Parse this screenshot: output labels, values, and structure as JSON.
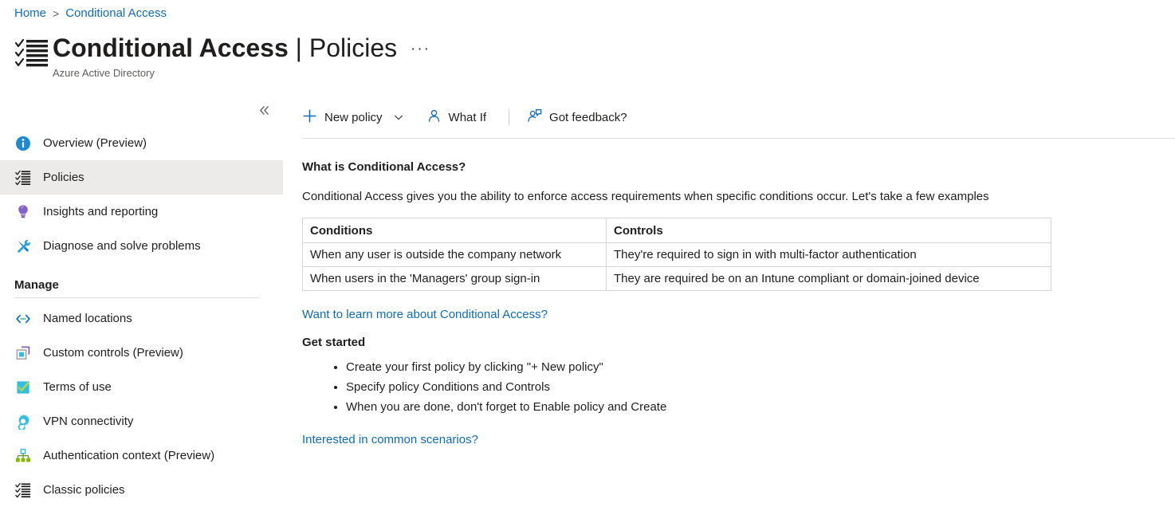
{
  "breadcrumb": {
    "home": "Home",
    "separator": ">",
    "current": "Conditional Access"
  },
  "header": {
    "title_bold": "Conditional Access",
    "title_separator": "|",
    "title_light": "Policies",
    "subtitle": "Azure Active Directory",
    "more_menu": "···",
    "icon": "checklist-icon"
  },
  "sidebar": {
    "collapse": "«",
    "items": [
      {
        "label": "Overview (Preview)",
        "icon": "info-circle-icon",
        "selected": false
      },
      {
        "label": "Policies",
        "icon": "checklist-icon",
        "selected": true
      },
      {
        "label": "Insights and reporting",
        "icon": "lightbulb-icon",
        "selected": false
      },
      {
        "label": "Diagnose and solve problems",
        "icon": "wrench-screwdriver-icon",
        "selected": false
      }
    ],
    "manage_section": {
      "title": "Manage",
      "items": [
        {
          "label": "Named locations",
          "icon": "code-brackets-icon"
        },
        {
          "label": "Custom controls (Preview)",
          "icon": "layers-square-icon"
        },
        {
          "label": "Terms of use",
          "icon": "checkbox-check-icon"
        },
        {
          "label": "VPN connectivity",
          "icon": "gear-icon"
        },
        {
          "label": "Authentication context (Preview)",
          "icon": "hierarchy-tree-icon"
        },
        {
          "label": "Classic policies",
          "icon": "checklist-icon"
        }
      ]
    }
  },
  "toolbar": {
    "new_policy": "New policy",
    "new_policy_icon": "plus-icon",
    "new_policy_chevron": "chevron-down-icon",
    "what_if": "What If",
    "what_if_icon": "person-icon",
    "got_feedback": "Got feedback?",
    "got_feedback_icon": "person-feedback-icon"
  },
  "main": {
    "heading": "What is Conditional Access?",
    "description": "Conditional Access gives you the ability to enforce access requirements when specific conditions occur. Let's take a few examples",
    "table": {
      "headers": [
        "Conditions",
        "Controls"
      ],
      "rows": [
        [
          "When any user is outside the company network",
          "They're required to sign in with multi-factor authentication"
        ],
        [
          "When users in the 'Managers' group sign-in",
          "They are required be on an Intune compliant or domain-joined device"
        ]
      ]
    },
    "learn_more_link": "Want to learn more about Conditional Access?",
    "get_started_heading": "Get started",
    "steps": [
      "Create your first policy by clicking \"+ New policy\"",
      "Specify policy Conditions and Controls",
      "When you are done, don't forget to Enable policy and Create"
    ],
    "scenarios_link": "Interested in common scenarios?"
  },
  "colors": {
    "link": "#0f6cbd",
    "selected_row": "#edebe9",
    "border": "#d6d6d6",
    "text": "#201f1e",
    "subtle_text": "#605e5c"
  }
}
